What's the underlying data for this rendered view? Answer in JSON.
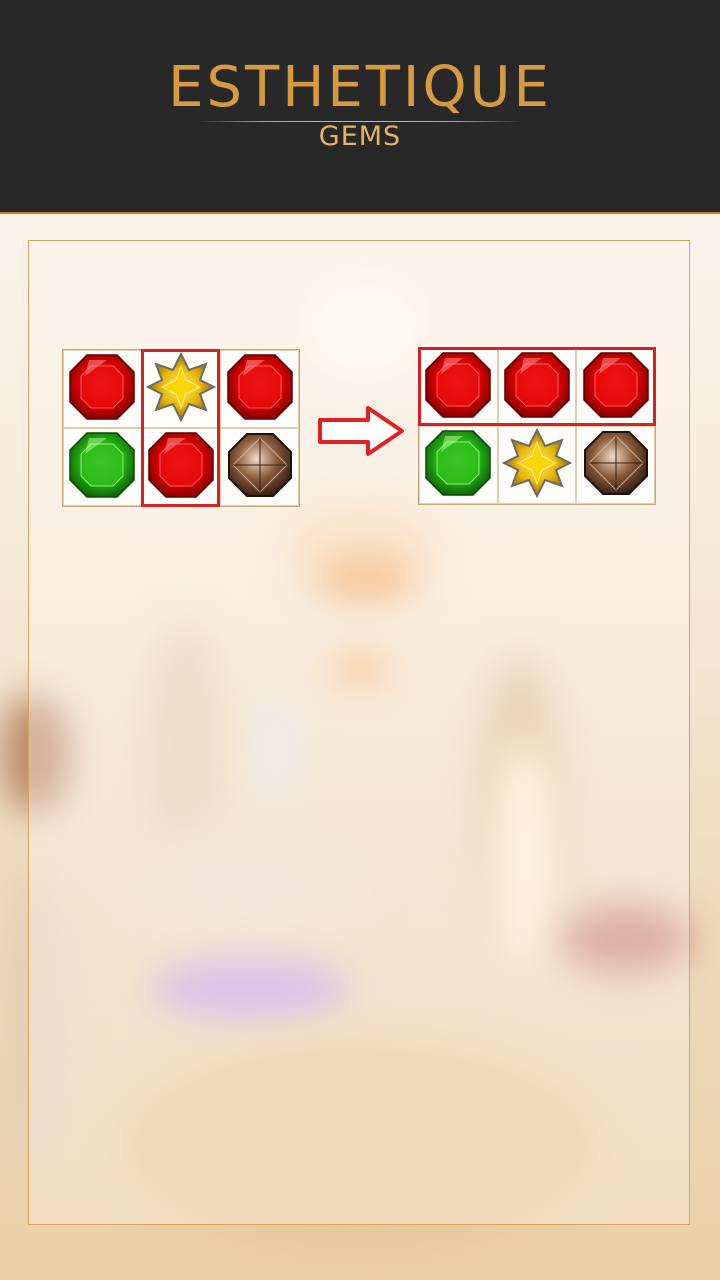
{
  "header": {
    "title": "ESTHETIQUE",
    "subtitle": "GEMS"
  },
  "colors": {
    "header_bg": "#282828",
    "gold": "#d79a3e",
    "highlight": "#d22424"
  },
  "tutorial": {
    "before_grid": [
      [
        "red-gem",
        "yellow-star-gem",
        "red-gem"
      ],
      [
        "green-gem",
        "red-gem",
        "brown-gem"
      ]
    ],
    "after_grid": [
      [
        "red-gem",
        "red-gem",
        "red-gem"
      ],
      [
        "green-gem",
        "yellow-star-gem",
        "brown-gem"
      ]
    ],
    "arrow_icon": "right-arrow-icon"
  }
}
